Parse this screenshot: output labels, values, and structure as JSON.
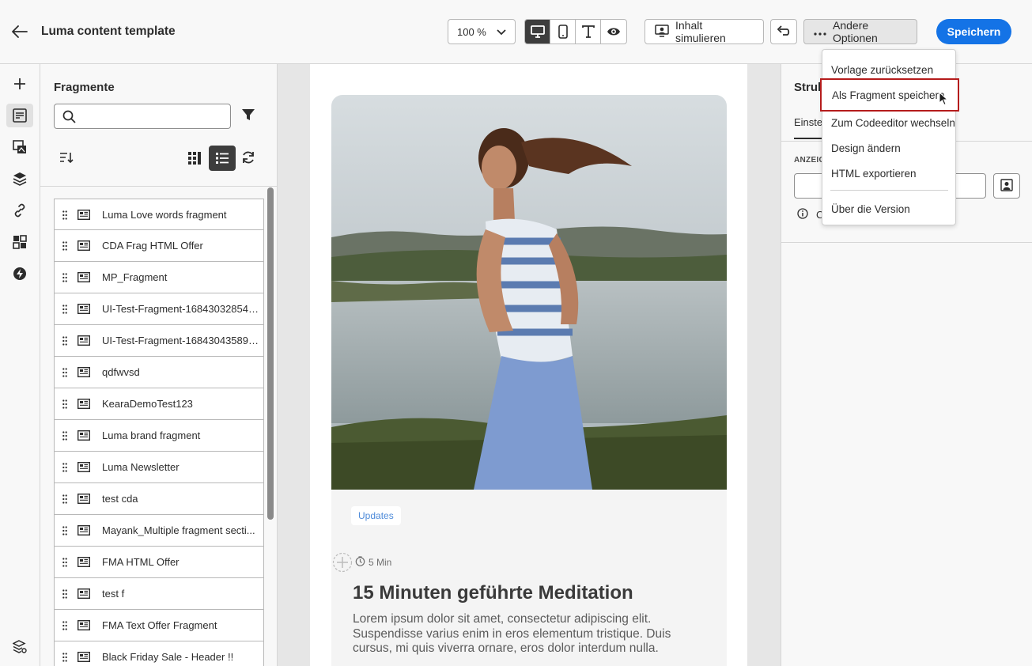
{
  "header": {
    "title": "Luma content template",
    "zoom_value": "100 %",
    "simulate_label": "Inhalt simulieren",
    "more_options_label": "Andere Optionen",
    "save_label": "Speichern"
  },
  "fragments_panel": {
    "title": "Fragmente",
    "search_placeholder": "",
    "items": [
      {
        "label": "Luma Love words fragment"
      },
      {
        "label": "CDA Frag HTML Offer"
      },
      {
        "label": "MP_Fragment"
      },
      {
        "label": "UI-Test-Fragment-168430328546..."
      },
      {
        "label": "UI-Test-Fragment-168430435899..."
      },
      {
        "label": "qdfwvsd"
      },
      {
        "label": "KearaDemoTest123"
      },
      {
        "label": "Luma brand fragment"
      },
      {
        "label": "Luma Newsletter"
      },
      {
        "label": "test cda"
      },
      {
        "label": "Mayank_Multiple fragment secti..."
      },
      {
        "label": "FMA HTML Offer"
      },
      {
        "label": "test f"
      },
      {
        "label": "FMA Text Offer Fragment"
      },
      {
        "label": "Black Friday Sale - Header !!"
      }
    ]
  },
  "email": {
    "tag": "Updates",
    "read_time": "5 Min",
    "headline": "15 Minuten geführte Meditation",
    "body": "Lorem ipsum dolor sit amet, consectetur adipiscing elit. Suspendisse varius enim in eros elementum tristique. Duis cursus, mi quis viverra ornare, eros dolor interdum nulla."
  },
  "right_panel": {
    "title": "Struk",
    "tab": "Einstel",
    "label": "ANZEIG",
    "info_text": "C"
  },
  "menu": {
    "items": [
      {
        "label": "Vorlage zurücksetzen"
      },
      {
        "label": "Als Fragment speichern"
      },
      {
        "label": "Zum Codeeditor wechseln"
      },
      {
        "label": "Design ändern"
      },
      {
        "label": "HTML exportieren"
      },
      {
        "label": "Über die Version"
      }
    ]
  },
  "colors": {
    "accent": "#1473e6",
    "highlight_border": "#b51c1c",
    "tag_text": "#4e8bd9"
  }
}
